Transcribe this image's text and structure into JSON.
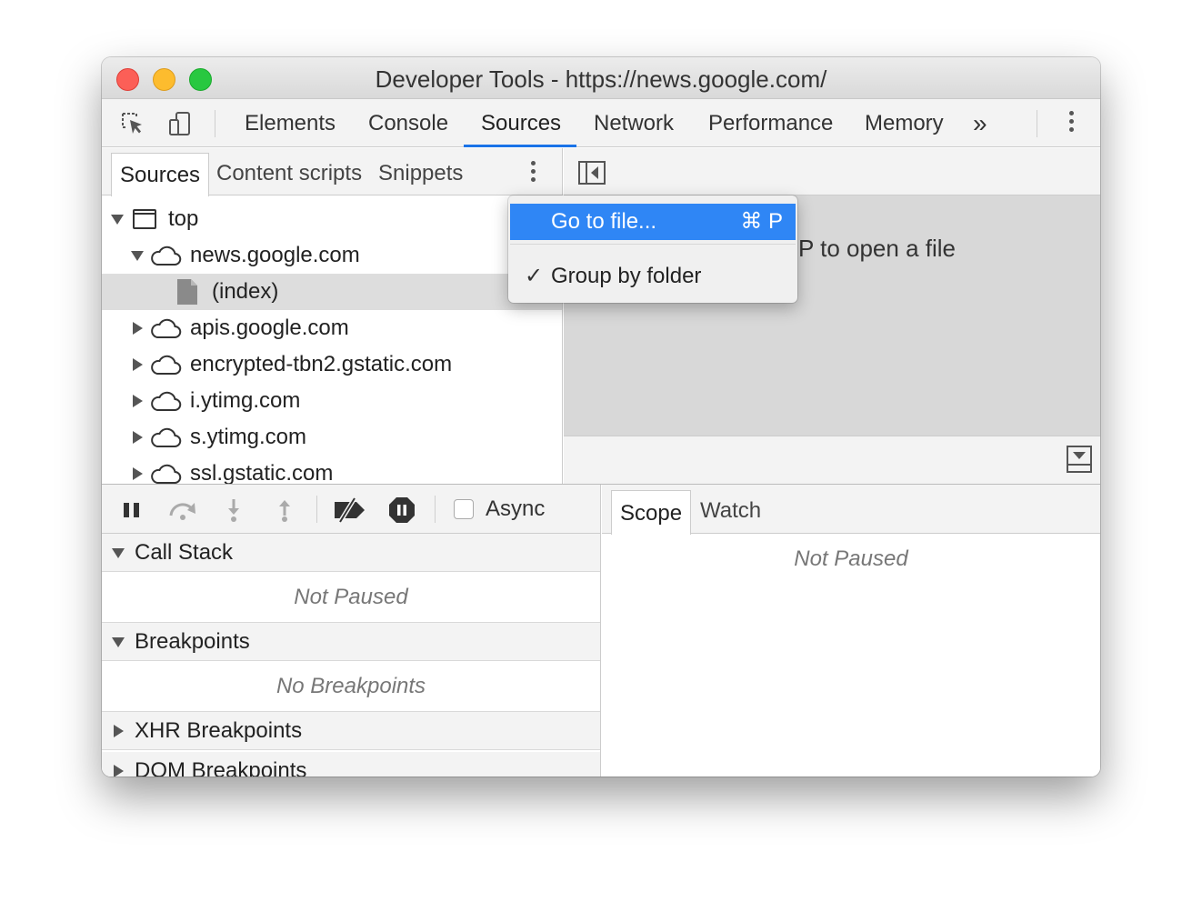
{
  "window": {
    "title": "Developer Tools - https://news.google.com/"
  },
  "toolbar": {
    "tabs": [
      {
        "label": "Elements"
      },
      {
        "label": "Console"
      },
      {
        "label": "Sources"
      },
      {
        "label": "Network"
      },
      {
        "label": "Performance"
      },
      {
        "label": "Memory"
      }
    ],
    "active_tab": "Sources",
    "more_label": "»"
  },
  "navigator": {
    "tabs": [
      {
        "label": "Sources"
      },
      {
        "label": "Content scripts"
      },
      {
        "label": "Snippets"
      }
    ],
    "tree": [
      {
        "label": "top"
      },
      {
        "label": "news.google.com"
      },
      {
        "label": "(index)"
      },
      {
        "label": "apis.google.com"
      },
      {
        "label": "encrypted-tbn2.gstatic.com"
      },
      {
        "label": "i.ytimg.com"
      },
      {
        "label": "s.ytimg.com"
      },
      {
        "label": "ssl.gstatic.com"
      }
    ]
  },
  "editor": {
    "hint": "P to open a file"
  },
  "context_menu": {
    "items": [
      {
        "label": "Go to file...",
        "shortcut": "⌘ P",
        "highlighted": true
      },
      {
        "label": "Group by folder",
        "checked": true,
        "check_glyph": "✓"
      }
    ]
  },
  "debugger": {
    "async_label": "Async",
    "sections": [
      {
        "title": "Call Stack",
        "expanded": true,
        "body": "Not Paused"
      },
      {
        "title": "Breakpoints",
        "expanded": true,
        "body": "No Breakpoints"
      },
      {
        "title": "XHR Breakpoints",
        "expanded": false
      },
      {
        "title": "DOM Breakpoints",
        "expanded": false
      }
    ]
  },
  "scope_panel": {
    "tabs": [
      {
        "label": "Scope"
      },
      {
        "label": "Watch"
      }
    ],
    "body": "Not Paused"
  },
  "colors": {
    "accent": "#1a73e8",
    "menu_highlight": "#2f86f5"
  }
}
